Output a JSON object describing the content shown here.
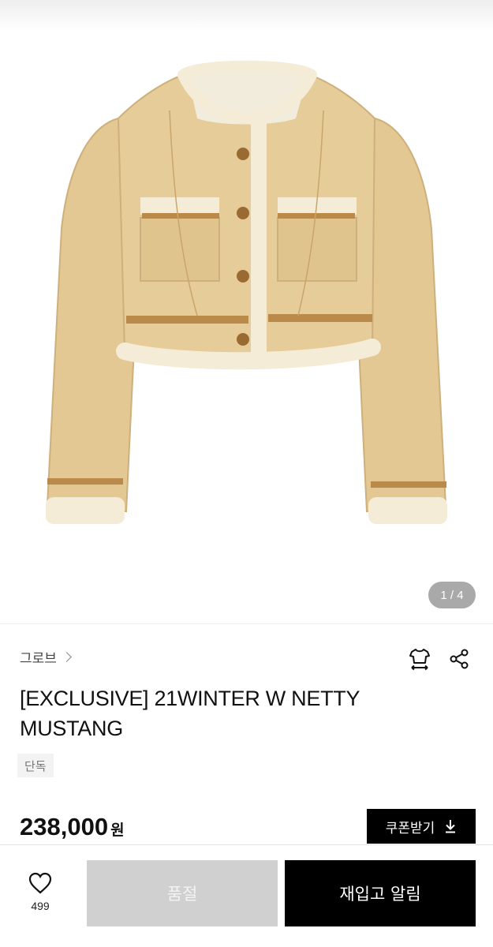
{
  "gallery": {
    "counter": "1 / 4",
    "current": 1,
    "total": 4,
    "image": "beige-shearling-cropped-jacket"
  },
  "product": {
    "brand": "그로브",
    "title": "[EXCLUSIVE] 21WINTER W NETTY MUSTANG",
    "badge": "단독",
    "price": "238,000",
    "currency": "원"
  },
  "actions": {
    "coupon_label": "쿠폰받기",
    "like_count": "499",
    "soldout_label": "품절",
    "restock_label": "재입고 알림"
  },
  "icons": {
    "fit": "size-guide-icon",
    "share": "share-icon",
    "like": "heart-icon",
    "download": "download-icon",
    "chevron": "chevron-right-icon"
  },
  "colors": {
    "primary": "#000000",
    "disabled": "#d0d0d0",
    "counter_bg": "#a9a9a9",
    "badge_bg": "#f3f3f3"
  }
}
